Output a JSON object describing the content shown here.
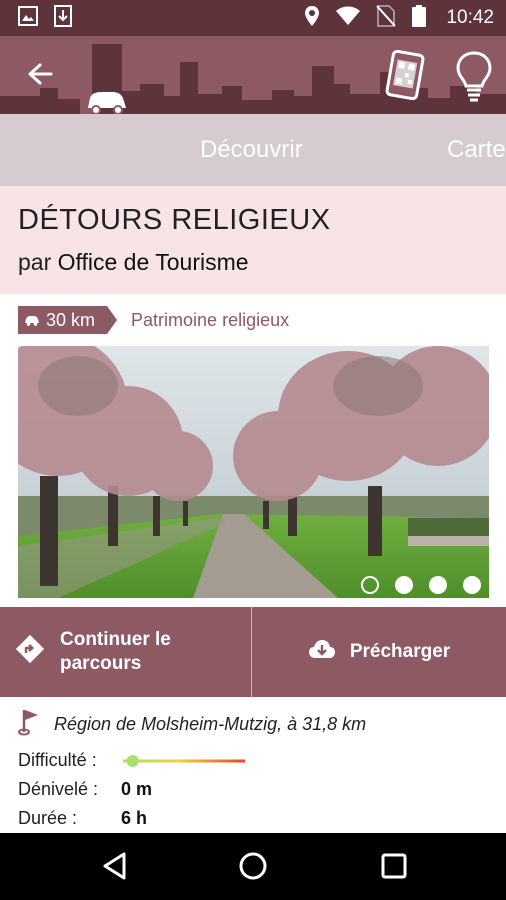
{
  "status_bar": {
    "time": "10:42",
    "icons": [
      "image-icon",
      "download-icon",
      "location-icon",
      "wifi-icon",
      "no-sim-icon",
      "battery-icon"
    ]
  },
  "app_bar": {
    "icons": [
      "back-arrow-icon",
      "qr-code-icon",
      "lightbulb-icon"
    ]
  },
  "tabs": [
    {
      "label": "Découvrir"
    },
    {
      "label": "Carte"
    }
  ],
  "tour": {
    "title": "DÉTOURS RELIGIEUX",
    "author_prefix": "par",
    "author": "Office de Tourisme",
    "distance": "30 km",
    "category": "Patrimoine religieux"
  },
  "photo": {
    "slide": 1,
    "total_slides": 4
  },
  "actions": {
    "continue_label": "Continuer le parcours",
    "preload_label": "Précharger"
  },
  "info": {
    "region": "Région de Molsheim-Mutzig, à 31,8 km",
    "difficulty_label": "Difficulté :",
    "difficulty_level": 0.05,
    "elevation_label": "Dénivelé :",
    "elevation_value": "0 m",
    "duration_label": "Durée :",
    "duration_value": "6 h"
  },
  "nav_bar": {
    "icons": [
      "back-triangle-icon",
      "home-circle-icon",
      "recents-square-icon"
    ]
  },
  "colors": {
    "primary": "#8d5962",
    "status_bar": "#5e3339",
    "tab_bar": "#d6cccf",
    "title_background": "#f8e4e6"
  }
}
